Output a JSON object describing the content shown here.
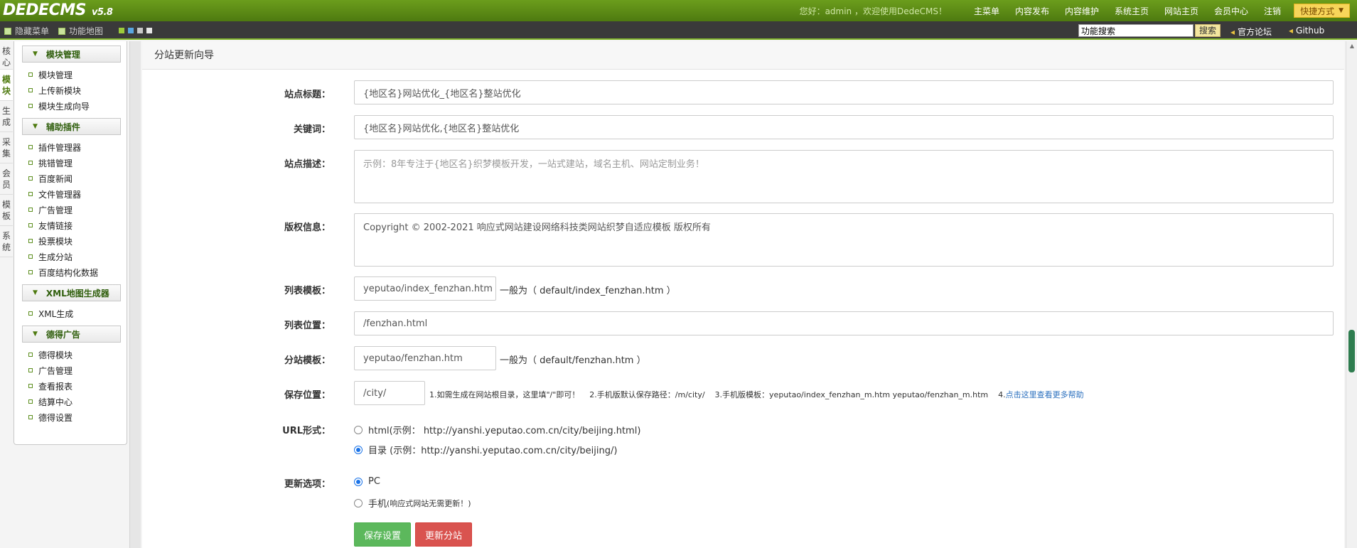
{
  "header": {
    "logo": "DEDECMS",
    "version": "v5.8",
    "welcome": "您好：admin ，欢迎使用DedeCMS！",
    "nav": [
      "主菜单",
      "内容发布",
      "内容维护",
      "系统主页",
      "网站主页",
      "会员中心",
      "注销"
    ],
    "quick": "快捷方式"
  },
  "subbar": {
    "hide_menu": "隐藏菜单",
    "function_map": "功能地图",
    "search_value": "功能搜索",
    "search_button": "搜索",
    "forum": "官方论坛",
    "github": "Github"
  },
  "vtabs": [
    {
      "label": "核心",
      "active": false
    },
    {
      "label": "模块",
      "active": true
    },
    {
      "label": "生成",
      "active": false
    },
    {
      "label": "采集",
      "active": false
    },
    {
      "label": "会员",
      "active": false
    },
    {
      "label": "模板",
      "active": false
    },
    {
      "label": "系统",
      "active": false
    }
  ],
  "menu": {
    "groups": [
      {
        "title": "模块管理",
        "items": [
          "模块管理",
          "上传新模块",
          "模块生成向导"
        ]
      },
      {
        "title": "辅助插件",
        "items": [
          "插件管理器",
          "挑错管理",
          "百度新闻",
          "文件管理器",
          "广告管理",
          "友情链接",
          "投票模块",
          "生成分站",
          "百度结构化数据"
        ]
      },
      {
        "title": "XML地图生成器",
        "items": [
          "XML生成"
        ]
      },
      {
        "title": "德得广告",
        "items": [
          "德得模块",
          "广告管理",
          "查看报表",
          "结算中心",
          "德得设置"
        ]
      }
    ]
  },
  "main": {
    "title": "分站更新向导",
    "site_title": {
      "label": "站点标题：",
      "value": "{地区名}网站优化_{地区名}整站优化"
    },
    "keywords": {
      "label": "关键词：",
      "value": "{地区名}网站优化,{地区名}整站优化"
    },
    "description": {
      "label": "站点描述：",
      "placeholder": "示例：8年专注于{地区名}织梦模板开发，一站式建站，域名主机、网站定制业务！"
    },
    "copyright": {
      "label": "版权信息：",
      "value": "Copyright © 2002-2021 响应式网站建设网络科技类网站织梦自适应模板 版权所有"
    },
    "list_template": {
      "label": "列表模板：",
      "value": "yeputao/index_fenzhan.htm",
      "hint": "一般为（ default/index_fenzhan.htm ）"
    },
    "list_position": {
      "label": "列表位置：",
      "value": "/fenzhan.html"
    },
    "sub_template": {
      "label": "分站模板：",
      "value": "yeputao/fenzhan.htm",
      "hint": "一般为（ default/fenzhan.htm ）"
    },
    "save_position": {
      "label": "保存位置：",
      "value": "/city/",
      "hint": "1.如需生成在网站根目录，这里填\"/\"即可！    2.手机版默认保存路径：/m/city/    3.手机版模板：yeputao/index_fenzhan_m.htm yeputao/fenzhan_m.htm    4.",
      "help_link": "点击这里查看更多帮助"
    },
    "url_form": {
      "label": "URL形式：",
      "options": [
        {
          "text": "html(示例： http://yanshi.yeputao.com.cn/city/beijing.html)",
          "checked": false
        },
        {
          "text": "目录 (示例：http://yanshi.yeputao.com.cn/city/beijing/)",
          "checked": true
        }
      ]
    },
    "update_options": {
      "label": "更新选项：",
      "options": [
        {
          "text": "PC",
          "note": "",
          "checked": true
        },
        {
          "text": "手机",
          "note": "(响应式网站无需更新！)",
          "checked": false
        }
      ]
    },
    "save_button": "保存设置",
    "update_button": "更新分站"
  },
  "colors": {
    "brand": "#5c8b16",
    "accent_blue": "#1a73e8",
    "btn_green": "#5cb85c",
    "btn_red": "#d9534f"
  }
}
